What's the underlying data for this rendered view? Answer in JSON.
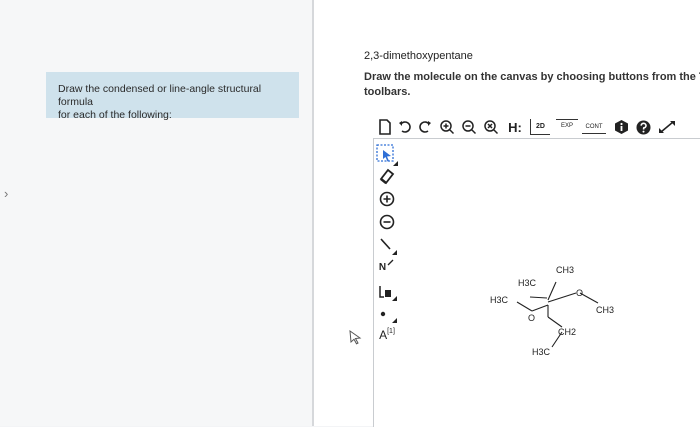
{
  "left": {
    "arrow": "›",
    "prompt_line1": "Draw the condensed or line-angle structural formula",
    "prompt_line2": "for each of the following:"
  },
  "question": {
    "compound_name": "2,3-dimethoxypentane",
    "instruction_line1": "Draw the molecule on the canvas by choosing buttons from the Tools (",
    "instruction_line2": "toolbars."
  },
  "toolbar": {
    "h_label": "H:",
    "twoD_label": "2D",
    "exp_label": "EXP",
    "cont_label": "CONT"
  },
  "side_tools": {
    "n_label": "N",
    "a_label": "A",
    "a_sup": "[1]"
  },
  "molecule": {
    "label_ch3_top": "CH3",
    "label_h3c_left_upper": "H3C",
    "label_h3c_left": "H3C",
    "label_o_left": "O",
    "label_o_right": "O",
    "label_ch3_right": "CH3",
    "label_ch2": "CH2",
    "label_h3c_bottom": "H3C"
  },
  "colors": {
    "prompt_bg": "#cfe2ec",
    "page_bg": "#f3f4f6",
    "canvas_bg": "#ffffff",
    "select_blue": "#2f6fd6"
  }
}
